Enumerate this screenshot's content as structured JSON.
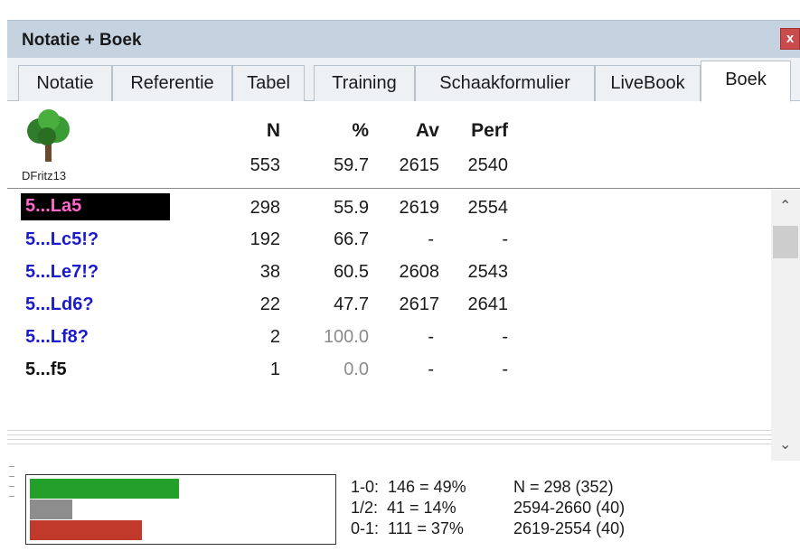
{
  "window": {
    "title": "Notatie + Boek",
    "close_label": "x"
  },
  "tabs": [
    {
      "label": "Notatie"
    },
    {
      "label": "Referentie"
    },
    {
      "label": "Tabel"
    },
    {
      "label": "Training"
    },
    {
      "label": "Schaakformulier"
    },
    {
      "label": "LiveBook"
    },
    {
      "label": "Boek",
      "active": true
    }
  ],
  "header": {
    "book_name": "DFritz13",
    "icon": "tree-icon",
    "columns": {
      "n": "N",
      "pct": "%",
      "av": "Av",
      "perf": "Perf"
    },
    "totals": {
      "n": "553",
      "pct": "59.7",
      "av": "2615",
      "perf": "2540"
    }
  },
  "moves": [
    {
      "move": "5...La5",
      "n": "298",
      "pct": "55.9",
      "av": "2619",
      "perf": "2554",
      "selected": true
    },
    {
      "move": "5...Lc5!?",
      "n": "192",
      "pct": "66.7",
      "av": "-",
      "perf": "-"
    },
    {
      "move": "5...Le7!?",
      "n": "38",
      "pct": "60.5",
      "av": "2608",
      "perf": "2543"
    },
    {
      "move": "5...Ld6?",
      "n": "22",
      "pct": "47.7",
      "av": "2617",
      "perf": "2641"
    },
    {
      "move": "5...Lf8?",
      "n": "2",
      "pct": "100.0",
      "av": "-",
      "perf": "-"
    },
    {
      "move": "5...f5",
      "n": "1",
      "pct": "0.0",
      "av": "-",
      "perf": "-"
    }
  ],
  "stats": {
    "win_line": "1-0:  146 = 49%",
    "draw_line": "1/2:  41 = 14%",
    "loss_line": "0-1:  111 = 37%",
    "n_line": "N = 298 (352)",
    "range1": "2594-2660 (40)",
    "range2": "2619-2554 (40)",
    "win_fraction": 0.49,
    "draw_fraction": 0.14,
    "loss_fraction": 0.37,
    "colors": {
      "win": "#22a02a",
      "draw": "#8d8d8d",
      "loss": "#c0392b"
    }
  },
  "colors": {
    "titlebar": "#c5d3e1",
    "selected_bg": "#000000",
    "selected_text": "#ff66cc",
    "move_link": "#1a1acc"
  }
}
